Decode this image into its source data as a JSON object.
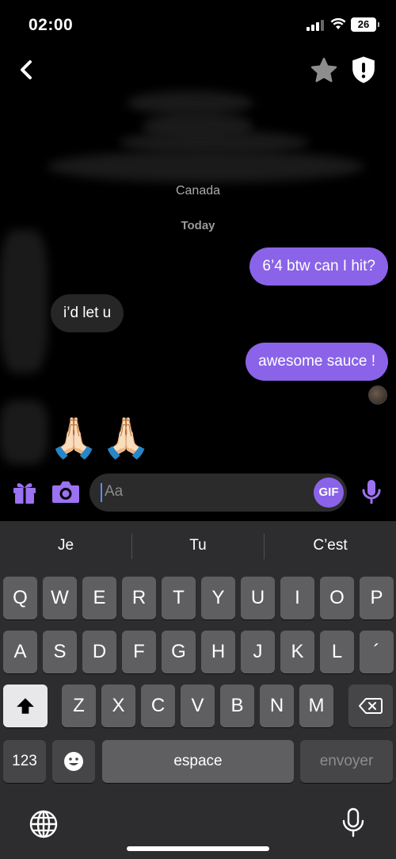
{
  "status_bar": {
    "time": "02:00",
    "battery": "26"
  },
  "chat": {
    "location": "Canada",
    "date_label": "Today",
    "messages": [
      {
        "side": "out",
        "text": "6’4 btw can I hit?"
      },
      {
        "side": "in",
        "text": "i’d let u"
      },
      {
        "side": "out",
        "text": "awesome sauce !"
      },
      {
        "side": "in",
        "text": "🙏🏻🙏🏻"
      }
    ]
  },
  "composer": {
    "placeholder": "Aa",
    "gif_label": "GIF"
  },
  "keyboard": {
    "suggestions": [
      "Je",
      "Tu",
      "C’est"
    ],
    "row1": [
      "Q",
      "W",
      "E",
      "R",
      "T",
      "Y",
      "U",
      "I",
      "O",
      "P"
    ],
    "row2": [
      "A",
      "S",
      "D",
      "F",
      "G",
      "H",
      "J",
      "K",
      "L",
      "´"
    ],
    "row3": [
      "Z",
      "X",
      "C",
      "V",
      "B",
      "N",
      "M"
    ],
    "numbers_label": "123",
    "space_label": "espace",
    "send_label": "envoyer"
  },
  "colors": {
    "accent": "#8a63e8",
    "incoming_bubble": "#262626",
    "keyboard_bg": "#2d2d2f"
  }
}
